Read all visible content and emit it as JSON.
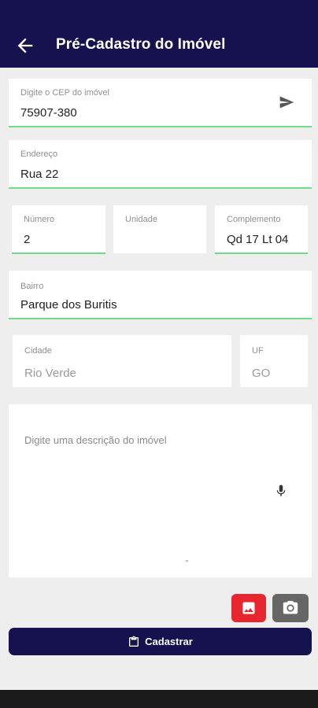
{
  "appbar": {
    "title": "Pré-Cadastro do Imóvel",
    "back_icon": "arrow-left-icon"
  },
  "form": {
    "cep": {
      "label": "Digite o CEP do imóvel",
      "value": "75907-380",
      "action_icon": "send-icon"
    },
    "endereco": {
      "label": "Endereço",
      "value": "Rua 22"
    },
    "numero": {
      "label": "Número",
      "value": "2"
    },
    "unidade": {
      "label": "Unidade",
      "value": ""
    },
    "complemento": {
      "label": "Complemento",
      "value": "Qd 17 Lt 04"
    },
    "bairro": {
      "label": "Bairro",
      "value": "Parque dos Buritis"
    },
    "cidade": {
      "label": "Cidade",
      "value": "Rio Verde"
    },
    "uf": {
      "label": "UF",
      "value": "GO"
    },
    "descricao": {
      "placeholder": "Digite uma descrição do imóvel",
      "action_icon": "microphone-icon"
    }
  },
  "media": {
    "gallery_icon": "image-icon",
    "camera_icon": "camera-icon"
  },
  "submit": {
    "label": "Cadastrar",
    "icon": "clipboard-icon"
  },
  "colors": {
    "primary": "#15124f",
    "accent_underline": "#6fdc8c",
    "gallery_button": "#e8262f",
    "camera_button": "#666666"
  }
}
